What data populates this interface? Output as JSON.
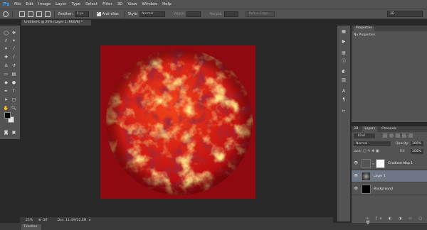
{
  "app": {
    "logo": "Ps"
  },
  "menu": [
    "File",
    "Edit",
    "Image",
    "Layer",
    "Type",
    "Select",
    "Filter",
    "3D",
    "View",
    "Window",
    "Help"
  ],
  "options": {
    "feather_label": "Feather:",
    "feather_value": "0 px",
    "antialias_label": "Anti-alias",
    "style_label": "Style:",
    "style_value": "Normal",
    "width_label": "Width:",
    "height_label": "Height:",
    "refine_edge": "Refine Edge...",
    "workspace": "3D"
  },
  "document": {
    "tab_title": "Untitled-1 @ 25% (Layer 1, RGB/8) *",
    "zoom": "25%",
    "off_label": "Off",
    "doc_info": "Doc: 11.4M/22.0M"
  },
  "bottom_tab": "Timeline",
  "properties": {
    "tab": "Properties",
    "body": "No Properties"
  },
  "layers": {
    "tabs": [
      "3D",
      "Layers",
      "Channels"
    ],
    "kind_filter": "Kind",
    "blend_mode": "Normal",
    "opacity_label": "Opacity:",
    "opacity_value": "100%",
    "lock_label": "Lock:",
    "fill_label": "Fill:",
    "fill_value": "100%",
    "items": [
      {
        "name": "Gradient Map 1"
      },
      {
        "name": "Layer 1"
      },
      {
        "name": "Background"
      }
    ]
  },
  "colors": {
    "canvas_bg": "#8e0a10",
    "accent": "#31a8ff"
  }
}
